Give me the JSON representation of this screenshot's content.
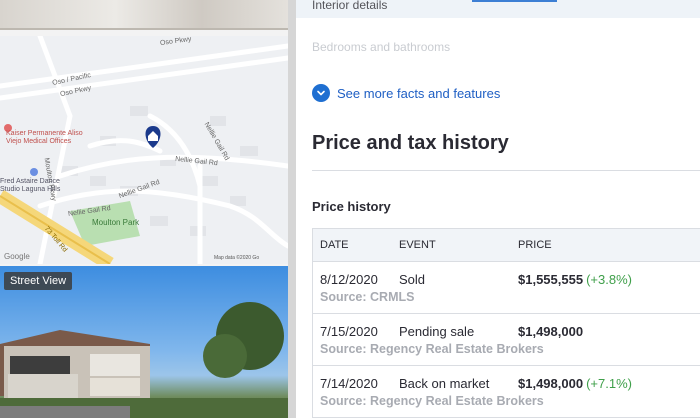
{
  "map": {
    "street_labels": [
      "Oso Pkwy",
      "Oso / Pacific",
      "Oso Pkwy",
      "Moulton Pkwy",
      "Nellie Gail Rd",
      "Nellie Gail Rd",
      "Nellie Gail Rd",
      "Nellie Gail Rd",
      "73 Toll Rd"
    ],
    "poi_kaiser": [
      "Kaiser Permanente Aliso",
      "Viejo Medical Offices"
    ],
    "poi_dance": [
      "Fred Astaire Dance",
      "Studio Laguna Hills"
    ],
    "poi_park": "Moulton Park",
    "attribution": "Map data ©2020 Go",
    "brand": "Google"
  },
  "street_view": {
    "label": "Street View"
  },
  "details": {
    "interior_label": "Interior details",
    "bedrooms_label": "Bedrooms and bathrooms",
    "see_more": "See more facts and features"
  },
  "history": {
    "heading": "Price and tax history",
    "subheading": "Price history",
    "columns": {
      "date": "DATE",
      "event": "EVENT",
      "price": "PRICE"
    },
    "rows": [
      {
        "date": "8/12/2020",
        "event": "Sold",
        "price": "$1,555,555",
        "change": "(+3.8%)",
        "source": "Source: CRMLS"
      },
      {
        "date": "7/15/2020",
        "event": "Pending sale",
        "price": "$1,498,000",
        "change": "",
        "source": "Source: Regency Real Estate Brokers"
      },
      {
        "date": "7/14/2020",
        "event": "Back on market",
        "price": "$1,498,000",
        "change": "(+7.1%)",
        "source": "Source: Regency Real Estate Brokers"
      }
    ]
  },
  "colors": {
    "link": "#1f5fc4",
    "accent": "#1f6fd1",
    "positive": "#3f9f4a",
    "muted": "#a8abb2"
  },
  "icons": {
    "pin": "home-pin-icon",
    "expand": "chevron-down-icon"
  }
}
